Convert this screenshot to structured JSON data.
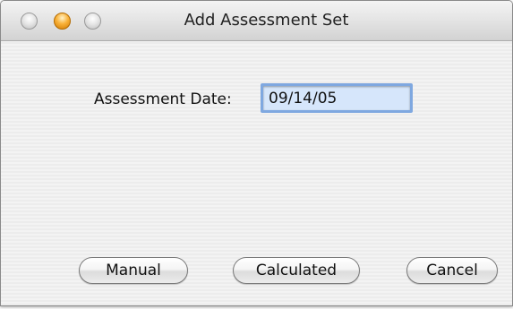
{
  "window": {
    "title": "Add Assessment Set"
  },
  "form": {
    "assessment_date_label": "Assessment Date:",
    "assessment_date_value": "09/14/05"
  },
  "buttons": {
    "manual": "Manual",
    "calculated": "Calculated",
    "cancel": "Cancel"
  },
  "icons": {
    "close": "close-icon",
    "minimize": "minimize-icon",
    "zoom": "zoom-icon"
  },
  "colors": {
    "input_focus": "#7fa8e0",
    "minimize_button": "#f9b23a"
  }
}
